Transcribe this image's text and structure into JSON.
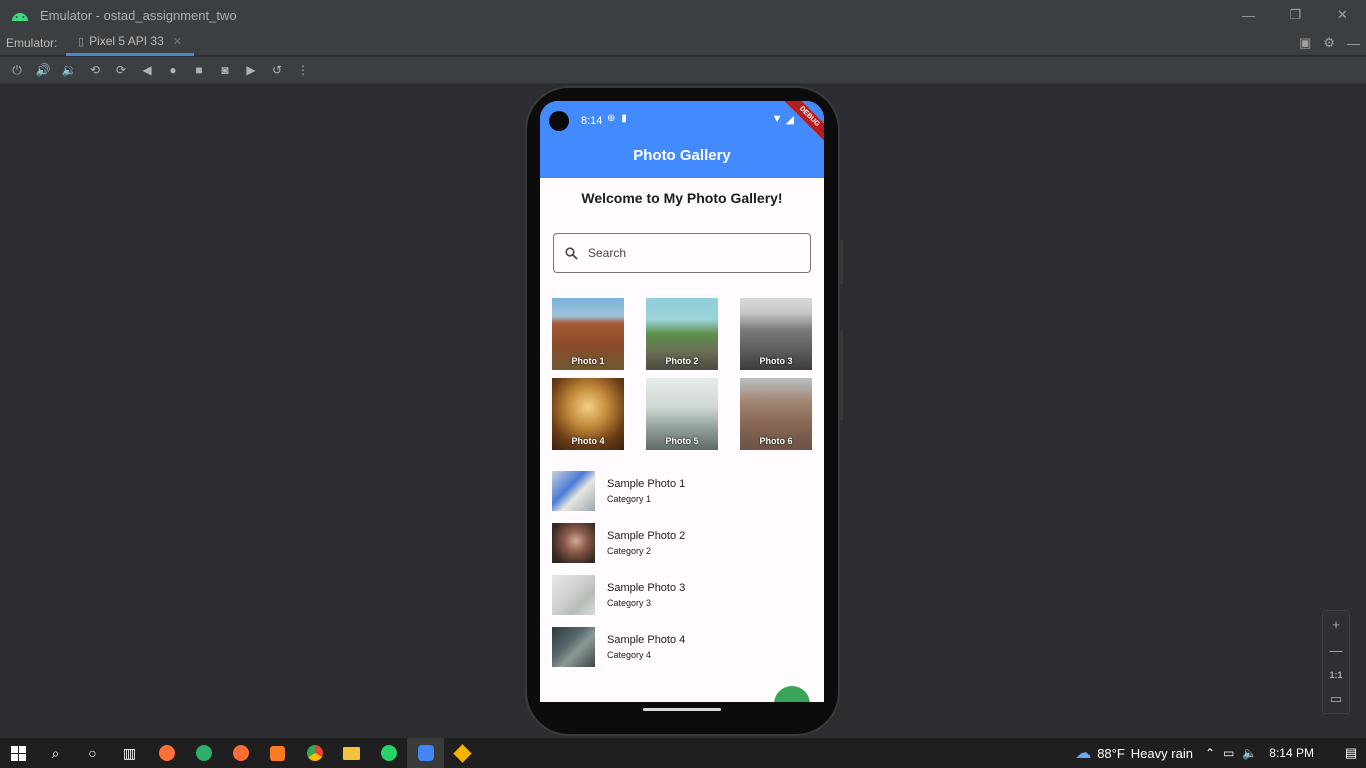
{
  "window": {
    "title": "Emulator - ostad_assignment_two"
  },
  "emulator_bar": {
    "label": "Emulator:",
    "device_tab": "Pixel 5 API 33"
  },
  "device": {
    "status_time": "8:14",
    "debug_banner": "DEBUG",
    "app_title": "Photo Gallery",
    "welcome": "Welcome to My Photo Gallery!",
    "search_placeholder": "Search",
    "photos": [
      {
        "caption": "Photo 1"
      },
      {
        "caption": "Photo 2"
      },
      {
        "caption": "Photo 3"
      },
      {
        "caption": "Photo 4"
      },
      {
        "caption": "Photo 5"
      },
      {
        "caption": "Photo 6"
      }
    ],
    "list": [
      {
        "title": "Sample Photo 1",
        "subtitle": "Category 1"
      },
      {
        "title": "Sample Photo 2",
        "subtitle": "Category 2"
      },
      {
        "title": "Sample Photo 3",
        "subtitle": "Category 3"
      },
      {
        "title": "Sample Photo 4",
        "subtitle": "Category 4"
      }
    ]
  },
  "zoom_panel": {
    "one_to_one": "1:1"
  },
  "taskbar": {
    "weather_temp": "88°F",
    "weather_desc": "Heavy rain",
    "time": "8:14 PM"
  },
  "colors": {
    "app_bar": "#448aff",
    "fab": "#3aa556",
    "ide_bg": "#2b2d30"
  }
}
